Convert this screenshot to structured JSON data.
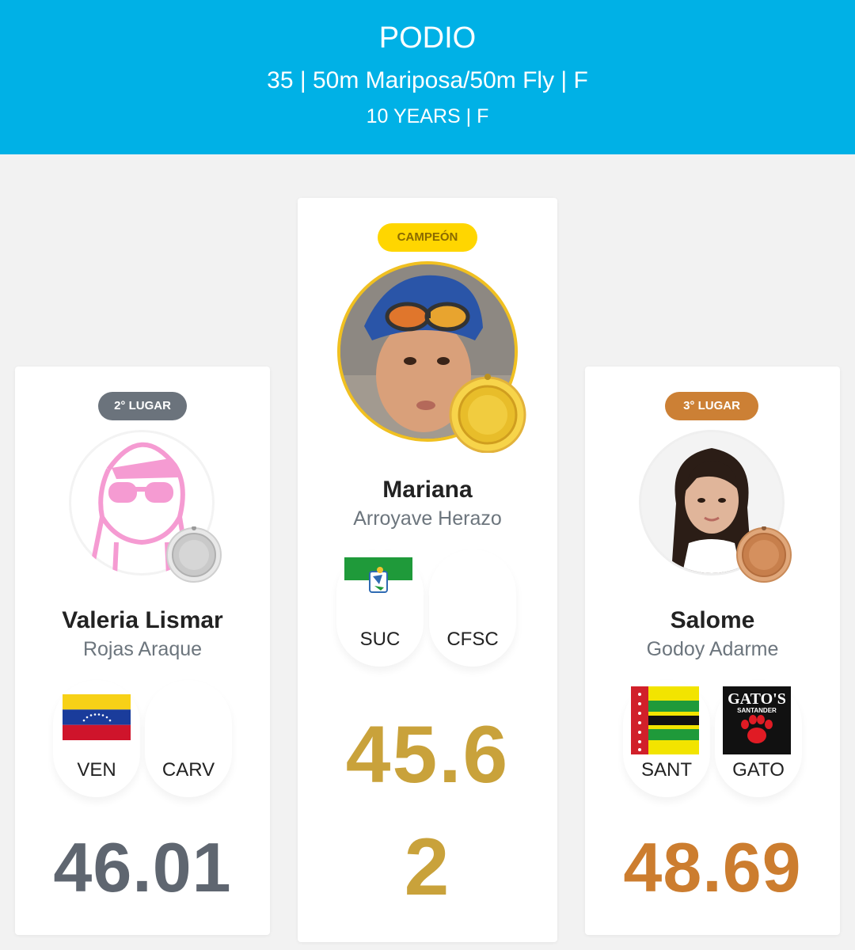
{
  "header": {
    "title": "PODIO",
    "event": "35 | 50m Mariposa/50m Fly | F",
    "category": "10 YEARS | F"
  },
  "colors": {
    "header_bg": "#00b1e6",
    "gold": "#c9a23b",
    "silver": "#5f6670",
    "bronze": "#cc7d2f",
    "gold_badge": "#ffd600",
    "silver_badge": "#6b737c",
    "bronze_badge": "#cc8035"
  },
  "podium": {
    "second": {
      "badge": "2° LUGAR",
      "first_name": "Valeria Lismar",
      "last_name": "Rojas Araque",
      "chips": [
        {
          "label": "VEN",
          "flag": "venezuela-flag-icon"
        },
        {
          "label": "CARV",
          "flag": ""
        }
      ],
      "time": "46.01",
      "avatar": "default-female-avatar-icon",
      "medal": "silver-medal-icon"
    },
    "first": {
      "badge": "CAMPEÓN",
      "first_name": "Mariana",
      "last_name": "Arroyave Herazo",
      "chips": [
        {
          "label": "SUC",
          "flag": "sucre-flag-icon"
        },
        {
          "label": "CFSC",
          "flag": ""
        }
      ],
      "time": "45.62",
      "avatar": "swimmer-photo",
      "medal": "gold-medal-icon"
    },
    "third": {
      "badge": "3° LUGAR",
      "first_name": "Salome",
      "last_name": "Godoy Adarme",
      "chips": [
        {
          "label": "SANT",
          "flag": "santander-flag-icon"
        },
        {
          "label": "GATO",
          "flag": "gatos-santander-logo"
        }
      ],
      "logo_text": "GATO'S SANTANDER",
      "time": "48.69",
      "avatar": "athlete-photo",
      "medal": "bronze-medal-icon"
    }
  }
}
